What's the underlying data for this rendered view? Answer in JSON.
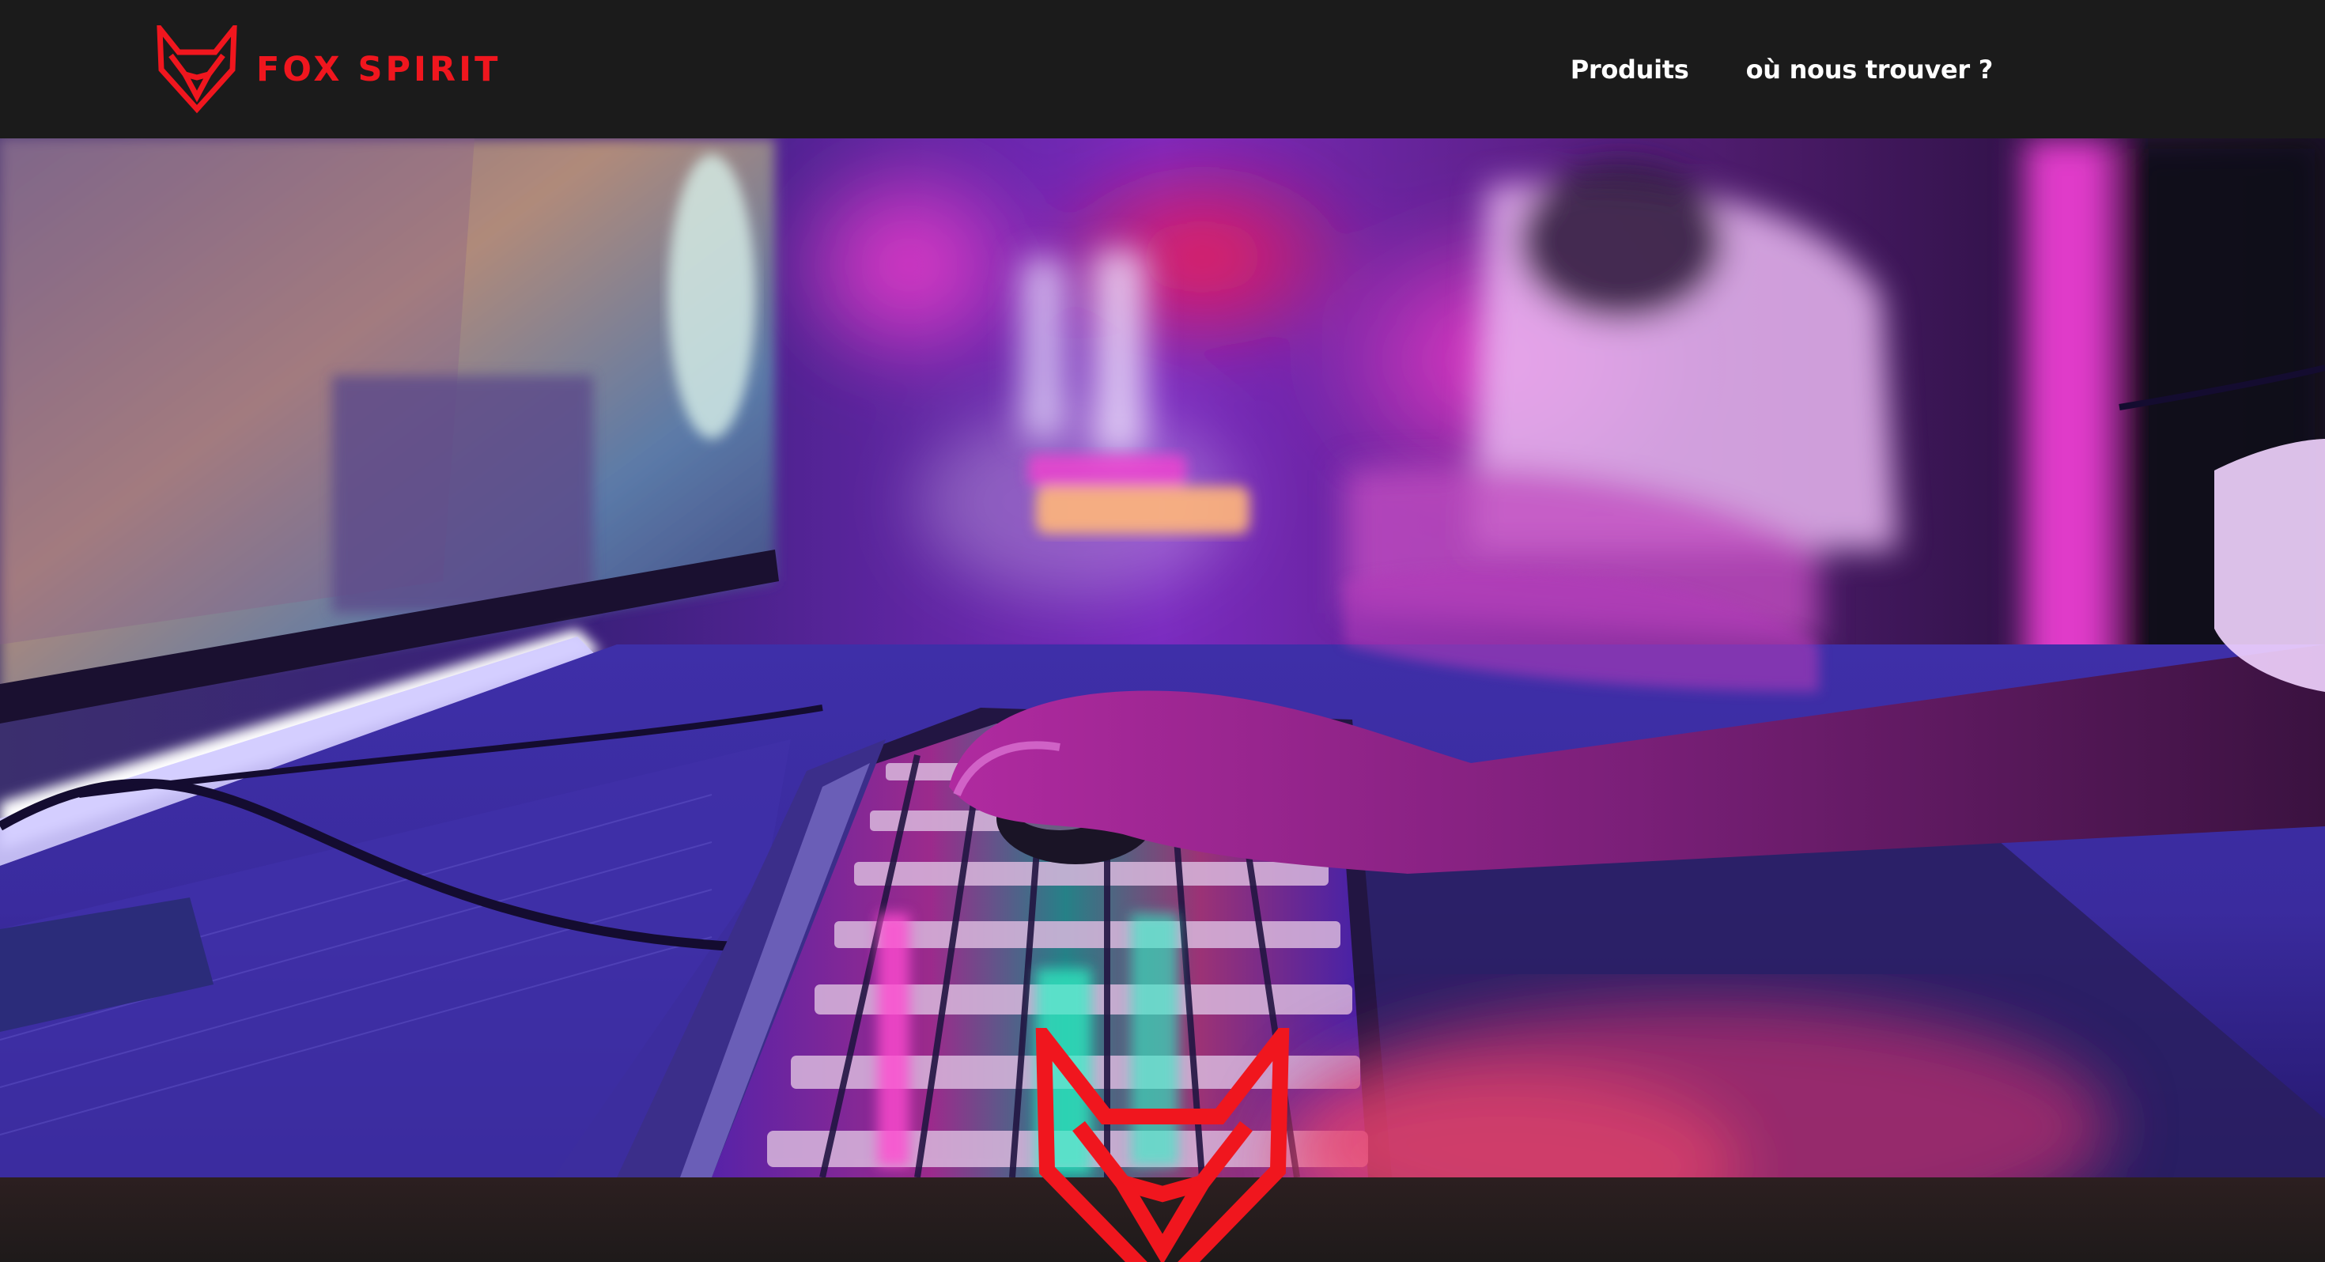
{
  "header": {
    "brand_name": "FOX SPIRIT",
    "logo_icon": "fox-head-icon",
    "nav": [
      {
        "label": "Produits"
      },
      {
        "label": "où nous trouver ?"
      }
    ]
  },
  "hero": {
    "image": "gaming-keyboard-neon-scene"
  },
  "colors": {
    "brand_red": "#f0161e",
    "header_bg": "#1b1b1b",
    "nav_text": "#ffffff",
    "neon_pink": "#ff2bd6",
    "neon_purple": "#6b1fd8",
    "neon_blue": "#2b5bff",
    "footer_band": "#241c1d"
  }
}
